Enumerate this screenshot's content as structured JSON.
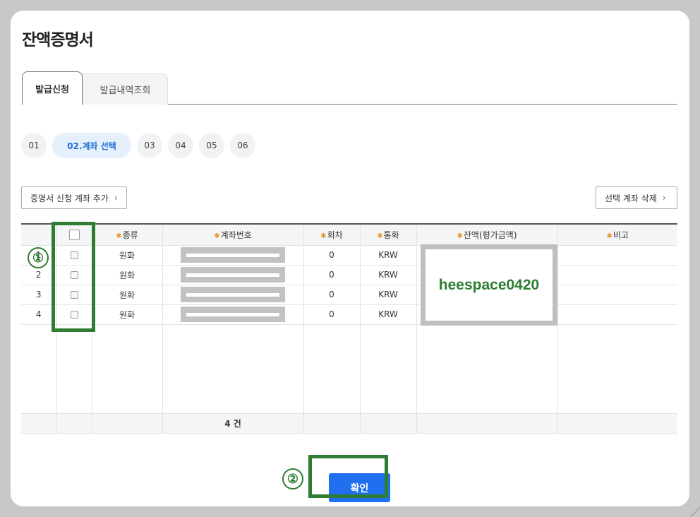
{
  "page": {
    "title": "잔액증명서"
  },
  "tabs": [
    {
      "label": "발급신청"
    },
    {
      "label": "발급내역조회"
    }
  ],
  "steps": [
    {
      "label": "01"
    },
    {
      "label": "02.계좌 선택"
    },
    {
      "label": "03"
    },
    {
      "label": "04"
    },
    {
      "label": "05"
    },
    {
      "label": "06"
    }
  ],
  "actions": {
    "add_label": "증명서 신청 계좌 추가",
    "delete_label": "선택 계좌 삭제"
  },
  "table": {
    "columns": [
      "종류",
      "계좌번호",
      "회차",
      "통화",
      "잔액(평가금액)",
      "비고"
    ],
    "rows": [
      {
        "no": "1",
        "type": "원화",
        "round": "0",
        "currency": "KRW"
      },
      {
        "no": "2",
        "type": "원화",
        "round": "0",
        "currency": "KRW"
      },
      {
        "no": "3",
        "type": "원화",
        "round": "0",
        "currency": "KRW"
      },
      {
        "no": "4",
        "type": "원화",
        "round": "0",
        "currency": "KRW"
      }
    ],
    "total": "4 건"
  },
  "overlay": {
    "watermark": "heespace0420"
  },
  "markers": {
    "one": "①",
    "two": "②"
  },
  "confirm": {
    "label": "확인"
  },
  "colors": {
    "accent": "#1f6ff0",
    "marker": "#2e7d32"
  }
}
